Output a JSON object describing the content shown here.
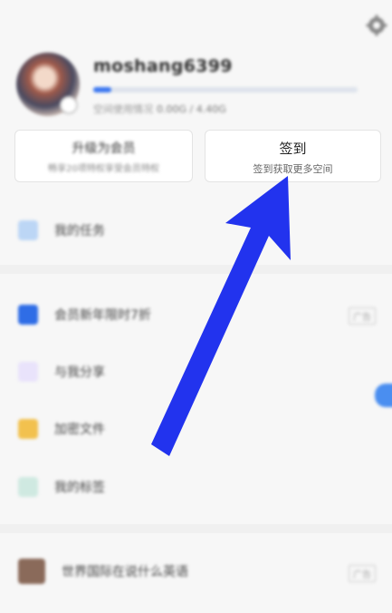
{
  "profile": {
    "username": "moshang6399",
    "storage_label": "空间使用情况",
    "storage_value": "0.00G / 4.40G",
    "storage_used_fraction": 0.07
  },
  "cards": {
    "vip_title": "升级为会员",
    "vip_sub": "畅享20项特权享受会员特权",
    "signin_title": "签到",
    "signin_sub": "签到获取更多空间"
  },
  "menu": {
    "tasks": "我的任务",
    "vip_promo": "会员新年限时7折",
    "shared": "与我分享",
    "encrypted": "加密文件",
    "tags": "我的标签",
    "game_ad": "世界国际在说什么英语"
  },
  "ad_tag": "广告",
  "colors": {
    "accent": "#3a76f0",
    "arrow": "#2233ee"
  },
  "icons": [
    "gear-icon",
    "tasks-icon",
    "vip-icon",
    "share-icon",
    "encrypted-file-icon",
    "tag-icon"
  ]
}
